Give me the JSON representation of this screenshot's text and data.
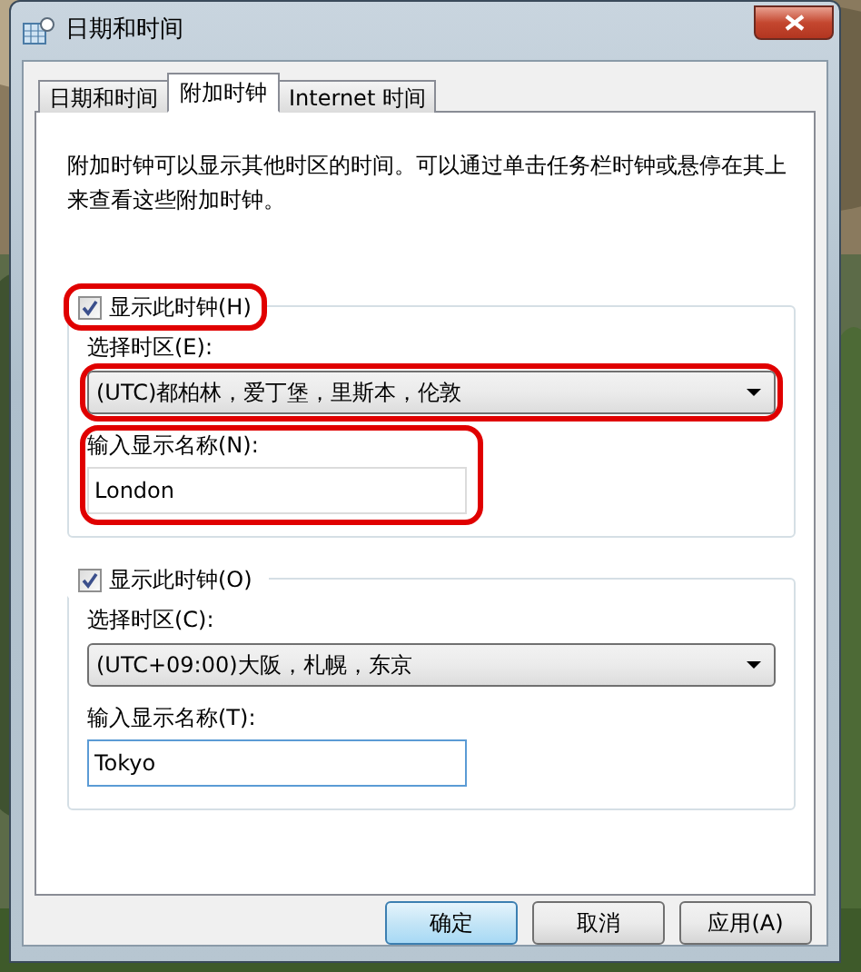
{
  "window": {
    "title": "日期和时间"
  },
  "tabs": [
    {
      "label": "日期和时间",
      "selected": false
    },
    {
      "label": "附加时钟",
      "selected": true
    },
    {
      "label": "Internet 时间",
      "selected": false
    }
  ],
  "description": "附加时钟可以显示其他时区的时间。可以通过单击任务栏时钟或悬停在其上来查看这些附加时钟。",
  "clocks": [
    {
      "show_label": "显示此时钟(H)",
      "checked": true,
      "highlighted": true,
      "timezone_label": "选择时区(E):",
      "timezone": "(UTC)都柏林，爱丁堡，里斯本，伦敦",
      "timezone_highlighted": true,
      "name_label": "输入显示名称(N):",
      "name": "London",
      "name_highlighted": true,
      "focused": false
    },
    {
      "show_label": "显示此时钟(O)",
      "checked": true,
      "highlighted": false,
      "timezone_label": "选择时区(C):",
      "timezone": "(UTC+09:00)大阪，札幌，东京",
      "timezone_highlighted": false,
      "name_label": "输入显示名称(T):",
      "name": "Tokyo",
      "name_highlighted": false,
      "focused": true
    }
  ],
  "buttons": [
    {
      "label": "确定",
      "default": true
    },
    {
      "label": "取消",
      "default": false
    },
    {
      "label": "应用(A)",
      "default": false
    }
  ]
}
